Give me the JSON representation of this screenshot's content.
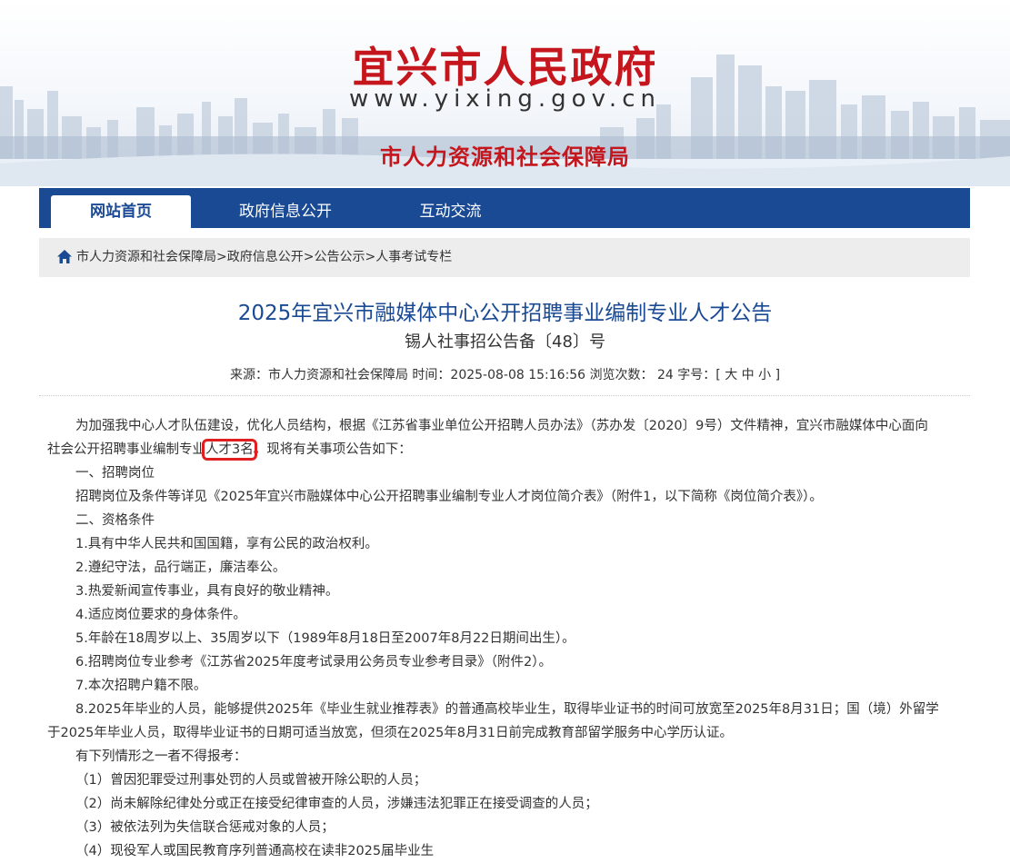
{
  "banner": {
    "site_title": "宜兴市人民政府",
    "site_url": "www.yixing.gov.cn",
    "bureau": "市人力资源和社会保障局"
  },
  "nav": {
    "items": [
      {
        "label": "网站首页",
        "active": true
      },
      {
        "label": "政府信息公开",
        "active": false
      },
      {
        "label": "互动交流",
        "active": false
      }
    ]
  },
  "breadcrumb": {
    "items": [
      "市人力资源和社会保障局",
      "政府信息公开",
      "公告公示",
      "人事考试专栏"
    ],
    "separator": ">"
  },
  "article": {
    "title": "2025年宜兴市融媒体中心公开招聘事业编制专业人才公告",
    "doc_number": "锡人社事招公告备〔48〕号",
    "meta": {
      "source": "来源：市人力资源和社会保障局",
      "time": "时间：2025-08-08 15:16:56",
      "views": "浏览次数：  24",
      "font_size_label": "字号：[",
      "size_large": "大",
      "size_medium": "中",
      "size_small": "小",
      "font_size_end": "]"
    },
    "paragraphs": {
      "p1_line1": "为加强我中心人才队伍建设，优化人员结构，根据《江苏省事业单位公开招聘人员办法》（苏办发〔2020〕9号）文件精神，宜兴市融媒体中心面向",
      "p1_line2_a": "社会公开招聘事业编制专业",
      "p1_line2_highlight": "人才3名",
      "p1_line2_b": "。现将有关事项公告如下：",
      "s1_heading": "一、招聘岗位",
      "s1_text": "招聘岗位及条件等详见《2025年宜兴市融媒体中心公开招聘事业编制专业人才岗位简介表》（附件1，以下简称《岗位简介表》）。",
      "s2_heading": "二、资格条件",
      "c1": "1.具有中华人民共和国国籍，享有公民的政治权利。",
      "c2": "2.遵纪守法，品行端正，廉洁奉公。",
      "c3": "3.热爱新闻宣传事业，具有良好的敬业精神。",
      "c4": "4.适应岗位要求的身体条件。",
      "c5": "5.年龄在18周岁以上、35周岁以下（1989年8月18日至2007年8月22日期间出生）。",
      "c6": "6.招聘岗位专业参考《江苏省2025年度考试录用公务员专业参考目录》（附件2）。",
      "c7": "7.本次招聘户籍不限。",
      "c8_line1": "8.2025年毕业的人员，能够提供2025年《毕业生就业推荐表》的普通高校毕业生，取得毕业证书的时间可放宽至2025年8月31日；国（境）外留学",
      "c8_line2": "于2025年毕业人员，取得毕业证书的日期可适当放宽，但须在2025年8月31日前完成教育部留学服务中心学历认证。",
      "excl_heading": "有下列情形之一者不得报考：",
      "e1": "（1）曾因犯罪受过刑事处罚的人员或曾被开除公职的人员；",
      "e2": "（2）尚未解除纪律处分或正在接受纪律审查的人员，涉嫌违法犯罪正在接受调查的人员；",
      "e3": "（3）被依法列为失信联合惩戒对象的人员；",
      "e4": "（4）现役军人或国民教育序列普通高校在读非2025届毕业生"
    }
  },
  "colors": {
    "brand_red": "#c4161c",
    "nav_blue": "#1a4a94",
    "highlight_red": "#e02020"
  }
}
